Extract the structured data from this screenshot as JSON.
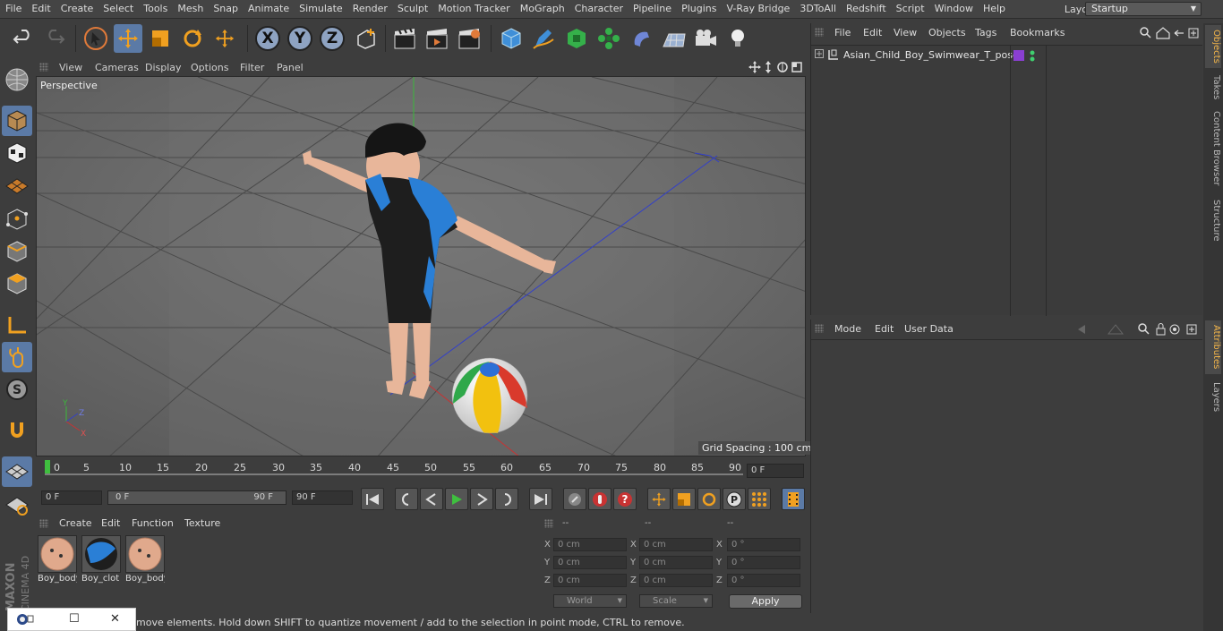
{
  "menubar": {
    "items": [
      "File",
      "Edit",
      "Create",
      "Select",
      "Tools",
      "Mesh",
      "Snap",
      "Animate",
      "Simulate",
      "Render",
      "Sculpt",
      "Motion Tracker",
      "MoGraph",
      "Character",
      "Pipeline",
      "Plugins",
      "V-Ray Bridge",
      "3DToAll",
      "Redshift",
      "Script",
      "Window",
      "Help"
    ],
    "layout_label": "Layout:",
    "layout_value": "Startup"
  },
  "viewport": {
    "menu": [
      "View",
      "Cameras",
      "Display",
      "Options",
      "Filter",
      "Panel"
    ],
    "label": "Perspective",
    "grid_spacing": "Grid Spacing : 100 cm",
    "axis_labels": [
      "Y",
      "Z",
      "X"
    ]
  },
  "timeline": {
    "ticks": [
      "0",
      "5",
      "10",
      "15",
      "20",
      "25",
      "30",
      "35",
      "40",
      "45",
      "50",
      "55",
      "60",
      "65",
      "70",
      "75",
      "80",
      "85",
      "90"
    ],
    "current_frame": "0 F",
    "start_frame": "0 F",
    "range_start": "0 F",
    "range_end": "90 F",
    "end_frame": "90 F"
  },
  "materials": {
    "menu": [
      "Create",
      "Edit",
      "Function",
      "Texture"
    ],
    "items": [
      {
        "name": "Boy_body"
      },
      {
        "name": "Boy_clot"
      },
      {
        "name": "Boy_body"
      }
    ]
  },
  "coords": {
    "headers": [
      "--",
      "--",
      "--"
    ],
    "rows": [
      {
        "axis1": "X",
        "v1": "0 cm",
        "axis2": "X",
        "v2": "0 cm",
        "axis3": "X",
        "v3": "0 °"
      },
      {
        "axis1": "Y",
        "v1": "0 cm",
        "axis2": "Y",
        "v2": "0 cm",
        "axis3": "Y",
        "v3": "0 °"
      },
      {
        "axis1": "Z",
        "v1": "0 cm",
        "axis2": "Z",
        "v2": "0 cm",
        "axis3": "Z",
        "v3": "0 °"
      }
    ],
    "mode1": "World",
    "mode2": "Scale",
    "apply": "Apply"
  },
  "status": {
    "text": "move elements. Hold down SHIFT to quantize movement / add to the selection in point mode, CTRL to remove."
  },
  "objects": {
    "menu": [
      "File",
      "Edit",
      "View",
      "Objects",
      "Tags",
      "Bookmarks"
    ],
    "items": [
      {
        "name": "Asian_Child_Boy_Swimwear_T_pose",
        "tag_color": "#8a3fd1"
      }
    ]
  },
  "attributes": {
    "menu": [
      "Mode",
      "Edit",
      "User Data"
    ]
  },
  "right_tabs": [
    "Objects",
    "Takes",
    "Content Browser",
    "Structure",
    "Attributes",
    "Layers"
  ],
  "brand": {
    "text1": "MAXON",
    "text2": "CINEMA 4D"
  },
  "colors": {
    "accent": "#5b7aa6",
    "active_tab": "#f3b54a",
    "play": "#3fbf3f"
  }
}
